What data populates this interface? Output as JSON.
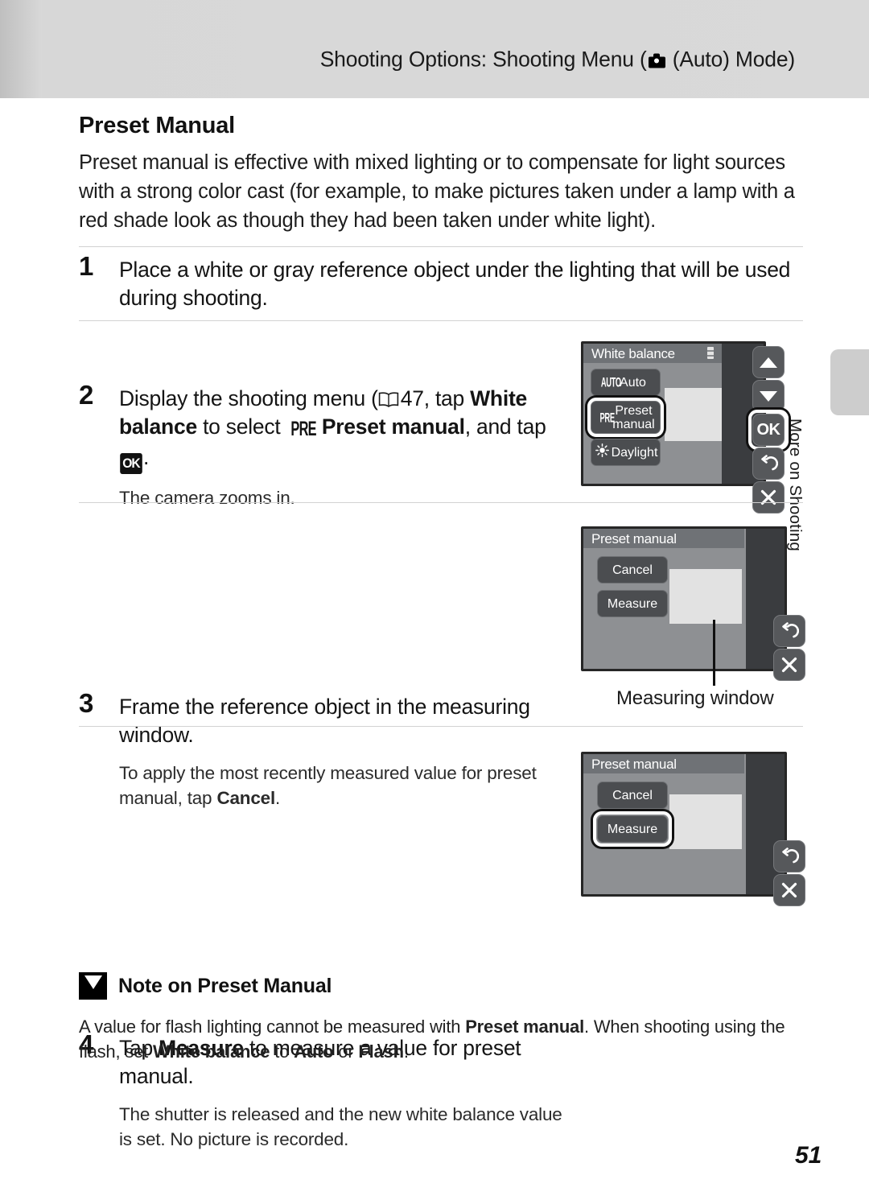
{
  "header": {
    "running_title_before": "Shooting Options: Shooting Menu (",
    "camera_icon": "camera-icon",
    "running_title_after": " (Auto) Mode)"
  },
  "side_tab": {
    "label": "More on Shooting"
  },
  "section": {
    "title": "Preset Manual",
    "intro": "Preset manual is effective with mixed lighting or to compensate for light sources with a strong color cast (for example, to make pictures taken under a lamp with a red shade look as though they had been taken under white light)."
  },
  "steps": [
    {
      "number": "1",
      "heading": "Place a white or gray reference object under the lighting that will be used during shooting.",
      "sub": ""
    },
    {
      "number": "2",
      "heading_p1": "Display the shooting menu (",
      "book_icon": "book-icon",
      "page_ref": "47",
      "heading_p2": ", tap ",
      "bold1": "White balance",
      "heading_p3": " to select ",
      "pre_glyph": "PRE",
      "bold2": "Preset manual",
      "heading_p4": ", and tap ",
      "ok_glyph": "OK",
      "heading_p5": ".",
      "sub": "The camera zooms in."
    },
    {
      "number": "3",
      "heading": "Frame the reference object in the measuring window.",
      "sub_p1": "To apply the most recently measured value for preset manual, tap ",
      "sub_bold": "Cancel",
      "sub_p2": "."
    },
    {
      "number": "4",
      "heading_p1": "Tap ",
      "heading_bold": "Measure",
      "heading_p2": " to measure a value for preset manual.",
      "sub": "The shutter is released and the new white balance value is set. No picture is recorded."
    }
  ],
  "screens": {
    "white_balance": {
      "title": "White balance",
      "items": [
        {
          "icon": "AUTO",
          "label": "Auto",
          "selected": false
        },
        {
          "icon": "PRE",
          "label": "Preset manual",
          "label_line1": "Preset",
          "label_line2": "manual",
          "selected": true
        },
        {
          "icon": "sun-icon",
          "label": "Daylight",
          "selected": false
        }
      ],
      "rail": [
        {
          "name": "scroll-up-button",
          "glyph": "triangle-up"
        },
        {
          "name": "scroll-down-button",
          "glyph": "triangle-down"
        },
        {
          "name": "ok-button",
          "glyph": "OK",
          "selected": true
        },
        {
          "name": "back-button",
          "glyph": "↺"
        },
        {
          "name": "close-button",
          "glyph": "✕"
        }
      ]
    },
    "preset_manual_step3": {
      "title": "Preset manual",
      "buttons": [
        {
          "label": "Cancel",
          "selected": false
        },
        {
          "label": "Measure",
          "selected": false
        }
      ],
      "rail": [
        {
          "name": "back-button",
          "glyph": "↺"
        },
        {
          "name": "close-button",
          "glyph": "✕"
        }
      ],
      "callout": "Measuring window"
    },
    "preset_manual_step4": {
      "title": "Preset manual",
      "buttons": [
        {
          "label": "Cancel",
          "selected": false
        },
        {
          "label": "Measure",
          "selected": true
        }
      ],
      "rail": [
        {
          "name": "back-button",
          "glyph": "↺"
        },
        {
          "name": "close-button",
          "glyph": "✕"
        }
      ]
    }
  },
  "note": {
    "icon": "caution-icon",
    "title": "Note on Preset Manual",
    "body_p1": "A value for flash lighting cannot be measured with ",
    "body_b1": "Preset manual",
    "body_p2": ". When shooting using the flash, set ",
    "body_b2": "White balance",
    "body_p3": " to ",
    "body_b3": "Auto",
    "body_p4": " or ",
    "body_b4": "Flash",
    "body_p5": "."
  },
  "page_number": "51"
}
